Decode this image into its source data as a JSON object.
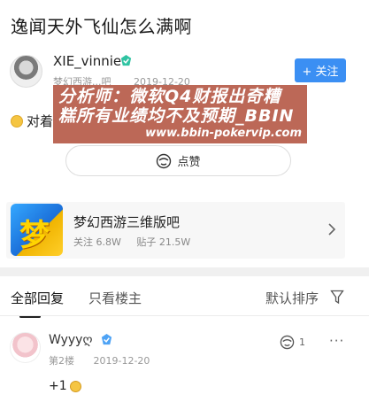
{
  "post": {
    "title": "逸闻天外飞仙怎么满啊",
    "author": {
      "name": "XIE_vinnie",
      "forum": "梦幻西游...吧",
      "date": "2019-12-20"
    },
    "follow_label": "+ 关注",
    "body_prefix": "对着",
    "like_label": "点赞"
  },
  "watermark": {
    "line1": "分析师：微软Q4财报出奇糟",
    "line2": "糕所有业绩均不及预期_BBIN",
    "url": "www.bbin-pokervip.com"
  },
  "forum_card": {
    "icon_glyph": "梦",
    "name": "梦幻西游三维版吧",
    "follows": "关注 6.8W",
    "posts": "贴子 21.5W"
  },
  "tabs": {
    "all_replies": "全部回复",
    "op_only": "只看楼主",
    "sort": "默认排序"
  },
  "reply": {
    "user": "Wyyyღ",
    "floor": "第2楼",
    "date": "2019-12-20",
    "like_count": "1",
    "more": "···",
    "text": "+1"
  },
  "colors": {
    "accent": "#3b8ff3",
    "watermark_bg": "#b9604f",
    "badge": "#2fc3a2"
  }
}
